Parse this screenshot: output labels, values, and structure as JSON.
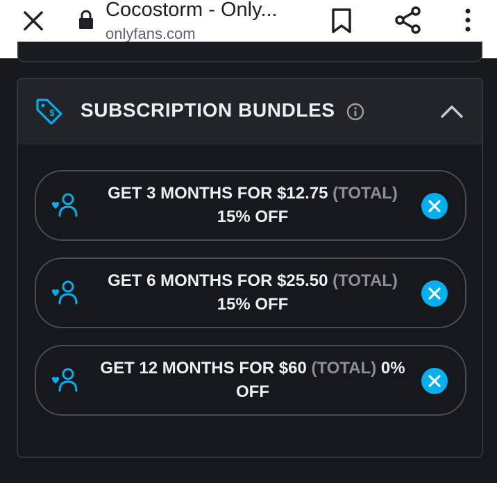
{
  "browser": {
    "title": "Cocostorm - Only...",
    "url": "onlyfans.com",
    "icons": {
      "close": "close-icon",
      "lock": "lock-icon",
      "bookmark": "bookmark-icon",
      "share": "share-icon",
      "menu": "more-vert-icon"
    }
  },
  "bundles": {
    "title": "SUBSCRIPTION BUNDLES",
    "icons": {
      "header": "price-tag-icon",
      "info": "info-icon",
      "collapse": "chevron-up-icon",
      "row": "subscriber-heart-icon",
      "remove": "remove-circle-icon"
    },
    "total_label": "(TOTAL)",
    "items": [
      {
        "line1": "GET 3 MONTHS FOR $12.75",
        "line2": "15% OFF"
      },
      {
        "line1": "GET 6 MONTHS FOR $25.50",
        "line2": "15% OFF"
      },
      {
        "line1": "GET 12 MONTHS FOR $60",
        "after_total": "0%",
        "line2": "OFF"
      }
    ]
  },
  "colors": {
    "accent": "#00aff0",
    "background": "#17181b",
    "header_bg": "#232428",
    "muted_text": "#8a8f99"
  }
}
